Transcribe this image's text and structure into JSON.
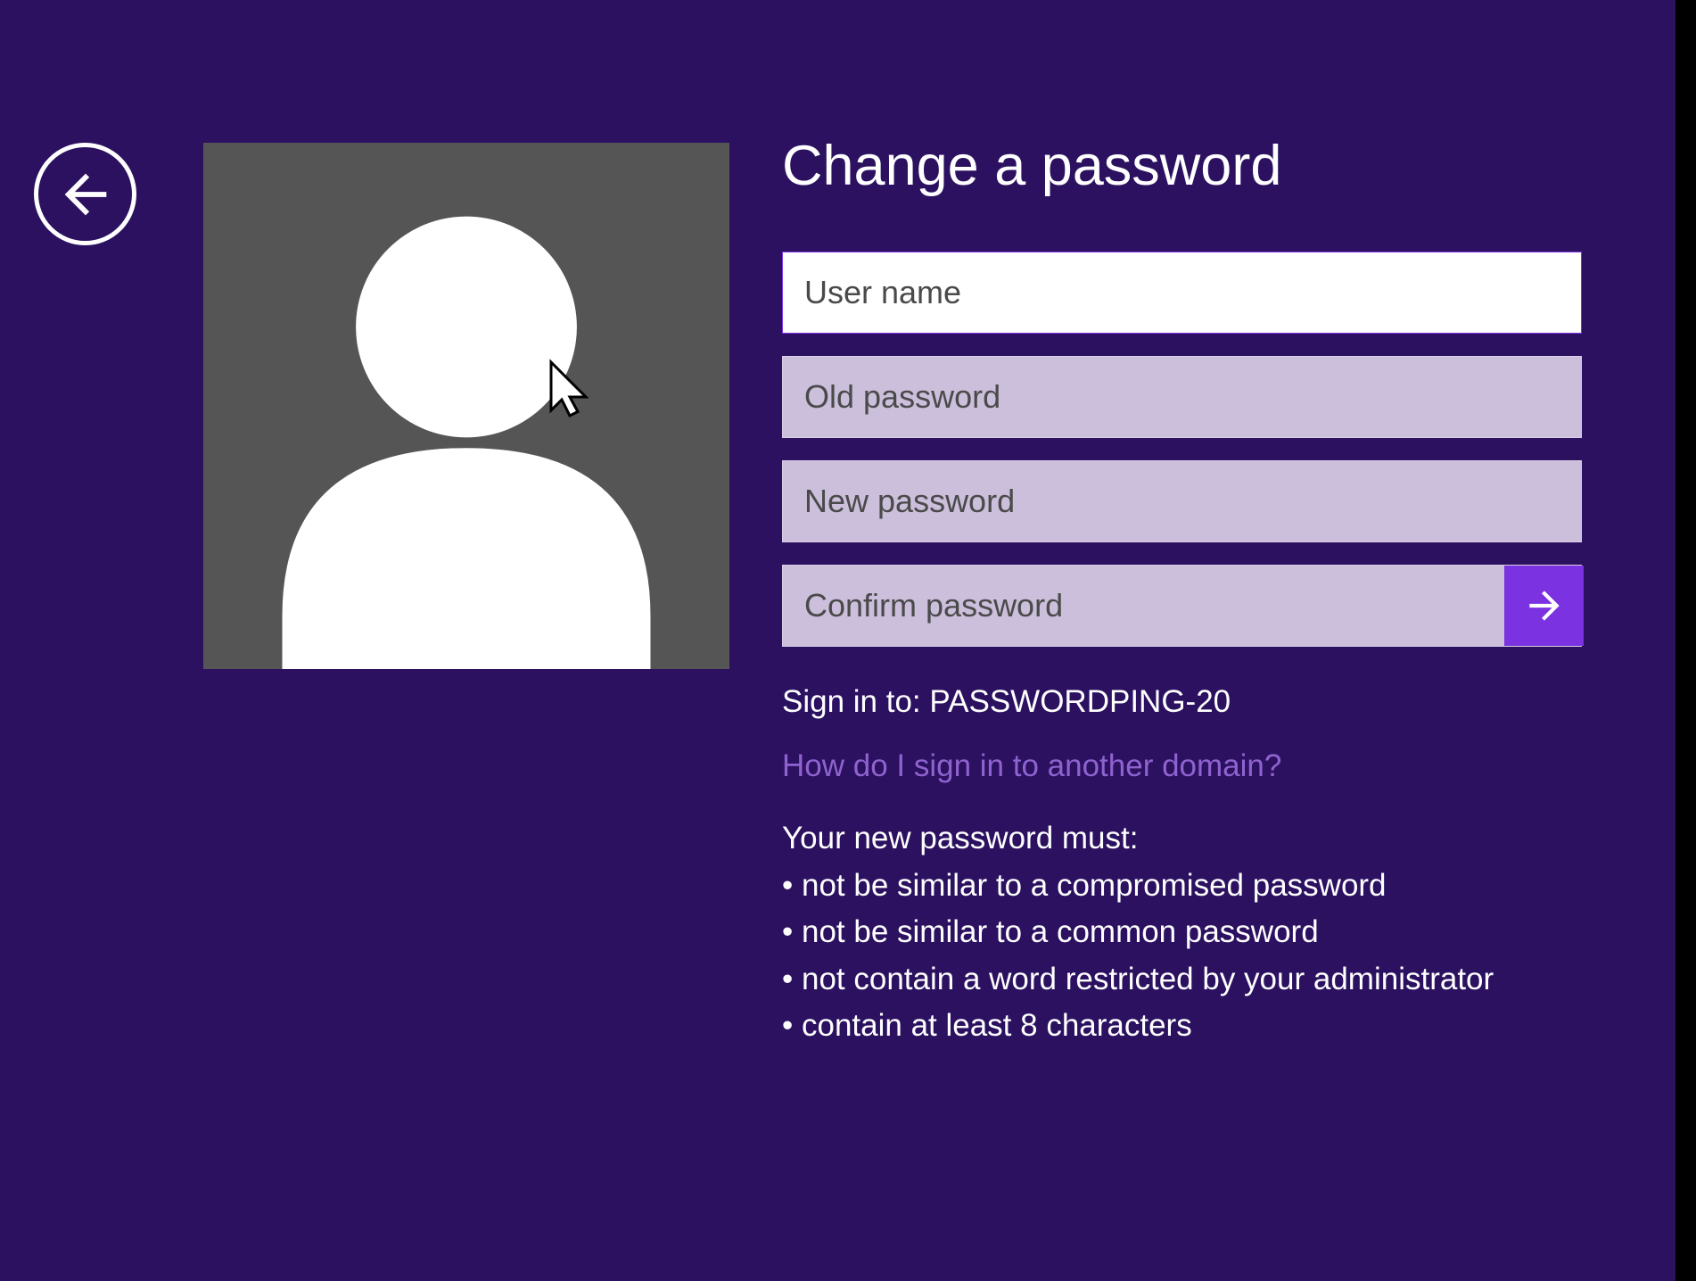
{
  "title": "Change a password",
  "inputs": {
    "username": {
      "placeholder": "User name",
      "value": ""
    },
    "old_password": {
      "placeholder": "Old password",
      "value": ""
    },
    "new_password": {
      "placeholder": "New password",
      "value": ""
    },
    "confirm_password": {
      "placeholder": "Confirm password",
      "value": ""
    }
  },
  "sign_in_to": "Sign in to: PASSWORDPING-20",
  "help_link": "How do I sign in to another domain?",
  "requirements": {
    "heading": "Your new password must:",
    "items": [
      "• not be similar to a compromised password",
      "• not be similar to a common password",
      "• not contain a word restricted by your administrator",
      "• contain at least 8 characters"
    ]
  },
  "icons": {
    "back": "back-arrow-icon",
    "submit": "submit-arrow-icon",
    "avatar": "user-avatar-icon",
    "cursor": "cursor-icon"
  },
  "colors": {
    "background": "#2b1160",
    "accent": "#7b32e0",
    "link": "#8f63cf",
    "input_bg": "#ccbfdc",
    "input_focus_bg": "#ffffff"
  }
}
